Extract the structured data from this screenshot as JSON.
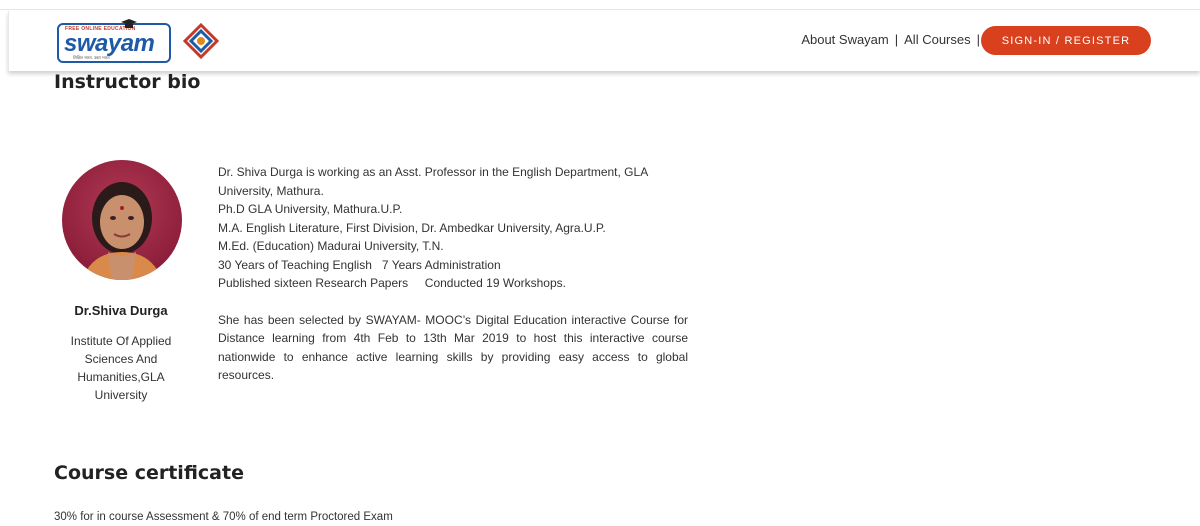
{
  "header": {
    "logo": {
      "tagline": "FREE ONLINE EDUCATION",
      "wordmark": "swayam",
      "subline": "शिक्षित भारत, उन्नत भारत"
    },
    "nav": [
      {
        "label": "About Swayam"
      },
      {
        "label": "All Courses"
      }
    ],
    "separator": "|",
    "signin_label": "SIGN-IN / REGISTER"
  },
  "instructor_section": {
    "title": "Instructor bio",
    "name": "Dr.Shiva Durga",
    "affiliation": "Institute Of Applied Sciences And Humanities,GLA University",
    "bio_lines": [
      "Dr. Shiva Durga is working as an Asst. Professor in the English Department, GLA University, Mathura.",
      "Ph.D GLA University, Mathura.U.P.",
      "M.A. English Literature, First Division, Dr. Ambedkar University, Agra.U.P.",
      "M.Ed. (Education) Madurai University, T.N.",
      "30 Years of Teaching English   7 Years Administration",
      "Published sixteen Research Papers     Conducted 19 Workshops."
    ],
    "bio_paragraph": "She has been selected by SWAYAM- MOOC’s Digital Education interactive Course for Distance learning  from 4th Feb to 13th Mar 2019 to host this interactive course nationwide to enhance active learning skills by providing easy access to global resources."
  },
  "certificate_section": {
    "title": "Course certificate",
    "text": "30% for in course Assessment & 70% of end term Proctored Exam"
  },
  "colors": {
    "accent": "#d9401d",
    "brand_blue": "#1e5aa8"
  }
}
